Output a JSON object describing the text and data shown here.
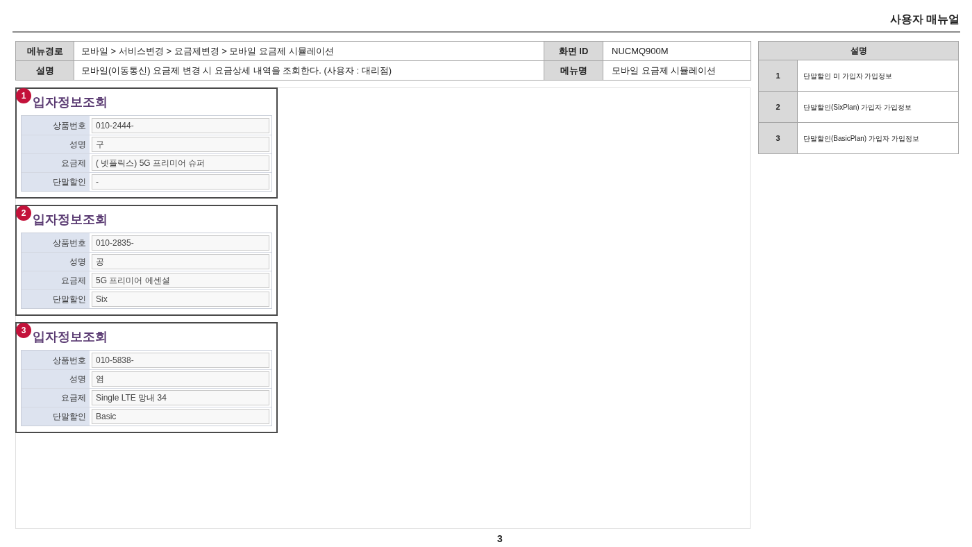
{
  "header": {
    "title": "사용자 매뉴얼"
  },
  "meta_table": {
    "rows": [
      {
        "label": "메뉴경로",
        "value": "모바일 > 서비스변경 > 요금제변경 > 모바일 요금제 시뮬레이션",
        "label_2": "화면 ID",
        "value_2": "NUCMQ900M"
      },
      {
        "label": "설명",
        "value": "모바일(이동통신) 요금제 변경 시 요금상세 내역을 조회한다. (사용자 : 대리점)",
        "label_2": "메뉴명",
        "value_2": "모바일 요금제 시뮬레이션"
      }
    ]
  },
  "panels": [
    {
      "badge": "1",
      "title": "입자정보조회",
      "fields": [
        {
          "label": "상품번호",
          "value": "010-2444-"
        },
        {
          "label": "성명",
          "value": "구"
        },
        {
          "label": "요금제",
          "value": "( 넷플릭스) 5G 프리미어 슈퍼"
        },
        {
          "label": "단말할인",
          "value": "-"
        }
      ]
    },
    {
      "badge": "2",
      "title": "입자정보조회",
      "fields": [
        {
          "label": "상품번호",
          "value": "010-2835-"
        },
        {
          "label": "성명",
          "value": "공"
        },
        {
          "label": "요금제",
          "value": "5G 프리미어 에센셜"
        },
        {
          "label": "단말할인",
          "value": "Six"
        }
      ]
    },
    {
      "badge": "3",
      "title": "입자정보조회",
      "fields": [
        {
          "label": "상품번호",
          "value": "010-5838-"
        },
        {
          "label": "성명",
          "value": "염"
        },
        {
          "label": "요금제",
          "value": "Single LTE 망내 34"
        },
        {
          "label": "단말할인",
          "value": "Basic"
        }
      ]
    }
  ],
  "description_table": {
    "header": "설명",
    "rows": [
      {
        "number": "1",
        "text": "단말할인 미 가입자 가입정보"
      },
      {
        "number": "2",
        "text": "단말할인(SixPlan) 가입자 가입정보"
      },
      {
        "number": "3",
        "text": "단말할인(BasicPlan) 가입자 가입정보"
      }
    ]
  },
  "page_number": "3"
}
